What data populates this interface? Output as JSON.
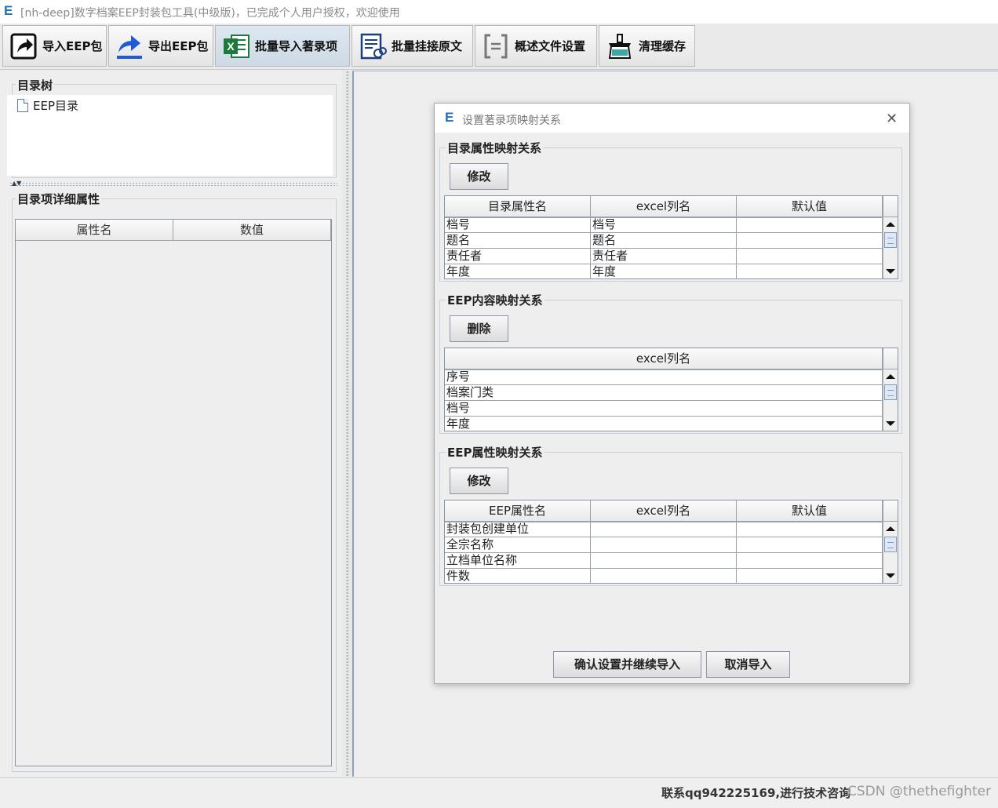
{
  "window": {
    "logo": "E",
    "title": "[nh-deep]数字档案EEP封装包工具(中级版)，已完成个人用户授权，欢迎使用"
  },
  "toolbar": {
    "buttons": [
      {
        "label": "导入EEP包",
        "icon": "import-icon"
      },
      {
        "label": "导出EEP包",
        "icon": "export-icon"
      },
      {
        "label": "批量导入著录项",
        "icon": "excel-icon"
      },
      {
        "label": "批量挂接原文",
        "icon": "attach-doc-icon"
      },
      {
        "label": "概述文件设置",
        "icon": "bracket-doc-icon"
      },
      {
        "label": "清理缓存",
        "icon": "broom-icon"
      }
    ]
  },
  "left": {
    "tree_title": "目录树",
    "tree_items": [
      "EEP目录"
    ],
    "detail_title": "目录项详细属性",
    "detail_columns": [
      "属性名",
      "数值"
    ]
  },
  "dialog": {
    "logo": "E",
    "title": "设置著录项映射关系",
    "close": "✕",
    "sections": [
      {
        "title": "目录属性映射关系",
        "button": "修改",
        "columns": [
          "目录属性名",
          "excel列名",
          "默认值"
        ],
        "rows": [
          [
            "档号",
            "档号",
            ""
          ],
          [
            "题名",
            "题名",
            ""
          ],
          [
            "责任者",
            "责任者",
            ""
          ],
          [
            "年度",
            "年度",
            ""
          ]
        ]
      },
      {
        "title": "EEP内容映射关系",
        "button": "删除",
        "columns": [
          "excel列名"
        ],
        "rows": [
          [
            "序号"
          ],
          [
            "档案门类"
          ],
          [
            "档号"
          ],
          [
            "年度"
          ]
        ]
      },
      {
        "title": "EEP属性映射关系",
        "button": "修改",
        "columns": [
          "EEP属性名",
          "excel列名",
          "默认值"
        ],
        "rows": [
          [
            "封装包创建单位",
            "",
            ""
          ],
          [
            "全宗名称",
            "",
            ""
          ],
          [
            "立档单位名称",
            "",
            ""
          ],
          [
            "件数",
            "",
            ""
          ]
        ]
      }
    ],
    "confirm_button": "确认设置并继续导入",
    "cancel_button": "取消导入"
  },
  "status": {
    "text": "联系qq942225169,进行技术咨询",
    "watermark": "CSDN @thethefighter"
  }
}
